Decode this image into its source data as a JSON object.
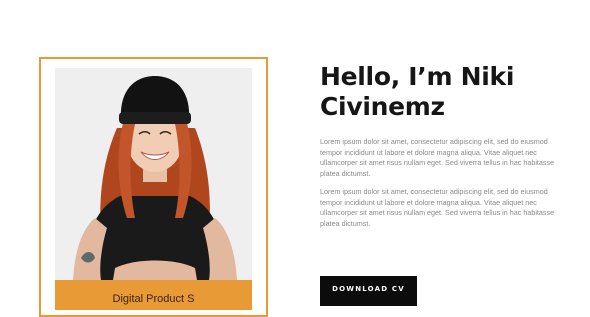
{
  "profile": {
    "heading": "Hello, I’m Niki Civinemz",
    "caption": "Digital Product S",
    "accent_color": "#e89a36"
  },
  "about": {
    "paragraph_1": "Lorem ipsum dolor sit amet, consectetur adipiscing elit, sed do eiusmod tempor incididunt ut labore et dolore magna aliqua. Vitae aliquet nec ullamcorper sit amet risus nullam eget. Sed viverra tellus in hac habitasse platea dictumst.",
    "paragraph_2": "Lorem ipsum dolor sit amet, consectetur adipiscing elit, sed do eiusmod tempor incididunt ut labore et dolore magna aliqua. Vitae aliquet nec ullamcorper sit amet risus nullam eget. Sed viverra tellus in hac habitasse platea dictumst."
  },
  "actions": {
    "download_label": "DOWNLOAD CV"
  }
}
